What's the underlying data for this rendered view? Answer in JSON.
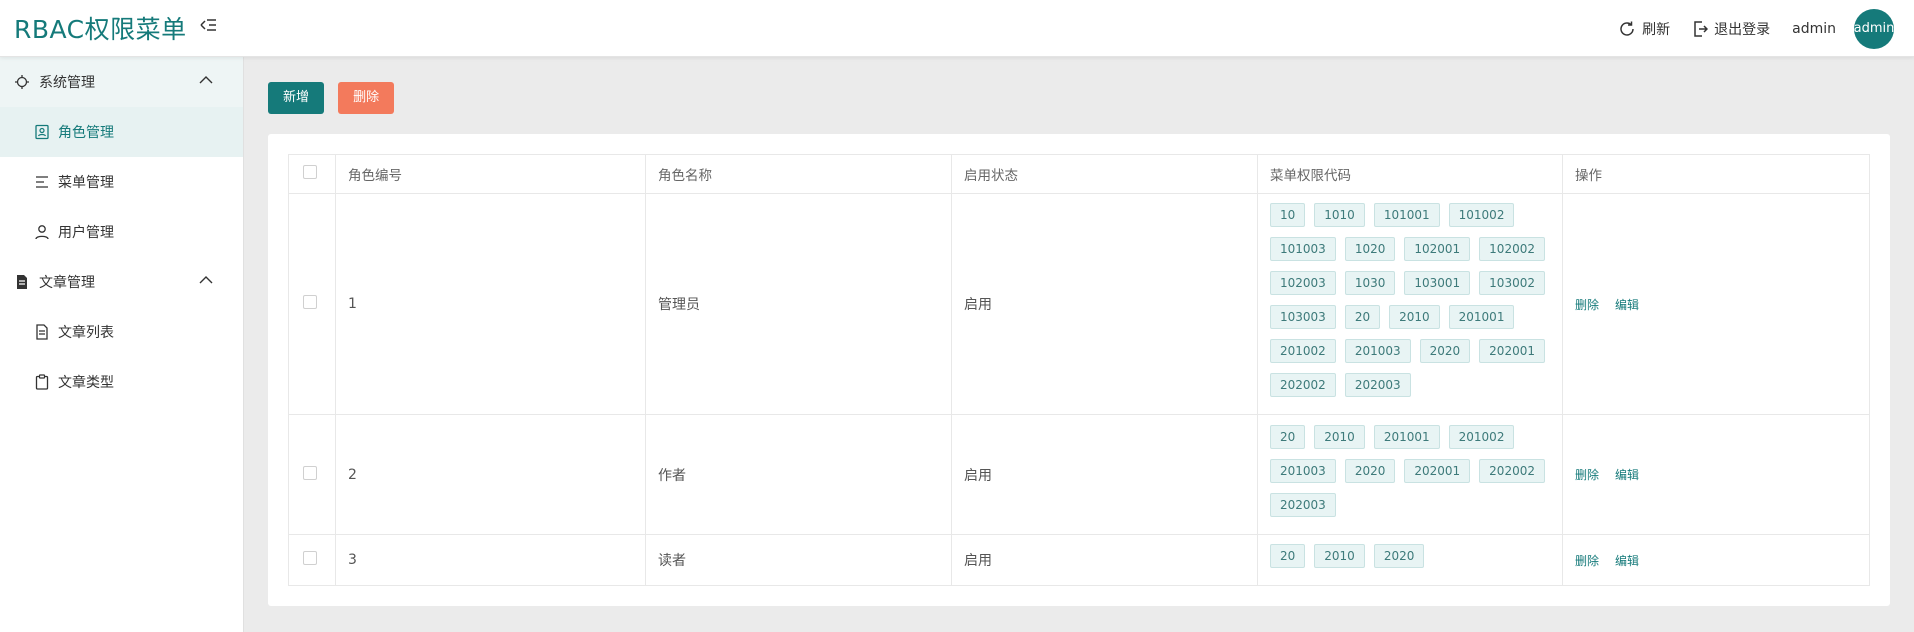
{
  "app": {
    "title": "RBAC权限菜单"
  },
  "header": {
    "refresh_label": "刷新",
    "logout_label": "退出登录",
    "username": "admin",
    "avatar_text": "admin"
  },
  "sidebar": {
    "groups": [
      {
        "label": "系统管理",
        "items": [
          {
            "label": "角色管理"
          },
          {
            "label": "菜单管理"
          },
          {
            "label": "用户管理"
          }
        ]
      },
      {
        "label": "文章管理",
        "items": [
          {
            "label": "文章列表"
          },
          {
            "label": "文章类型"
          }
        ]
      }
    ]
  },
  "toolbar": {
    "add_label": "新增",
    "delete_label": "删除"
  },
  "table": {
    "headers": [
      "角色编号",
      "角色名称",
      "启用状态",
      "菜单权限代码",
      "操作"
    ],
    "rows": [
      {
        "id": "1",
        "name": "管理员",
        "status": "启用",
        "codes": [
          "10",
          "1010",
          "101001",
          "101002",
          "101003",
          "1020",
          "102001",
          "102002",
          "102003",
          "1030",
          "103001",
          "103002",
          "103003",
          "20",
          "2010",
          "201001",
          "201002",
          "201003",
          "2020",
          "202001",
          "202002",
          "202003"
        ]
      },
      {
        "id": "2",
        "name": "作者",
        "status": "启用",
        "codes": [
          "20",
          "2010",
          "201001",
          "201002",
          "201003",
          "2020",
          "202001",
          "202002",
          "202003"
        ]
      },
      {
        "id": "3",
        "name": "读者",
        "status": "启用",
        "codes": [
          "20",
          "2010",
          "2020"
        ]
      }
    ],
    "op_delete": "删除",
    "op_edit": "编辑"
  },
  "colors": {
    "brand": "#157a7a",
    "danger": "#f37a5c"
  }
}
